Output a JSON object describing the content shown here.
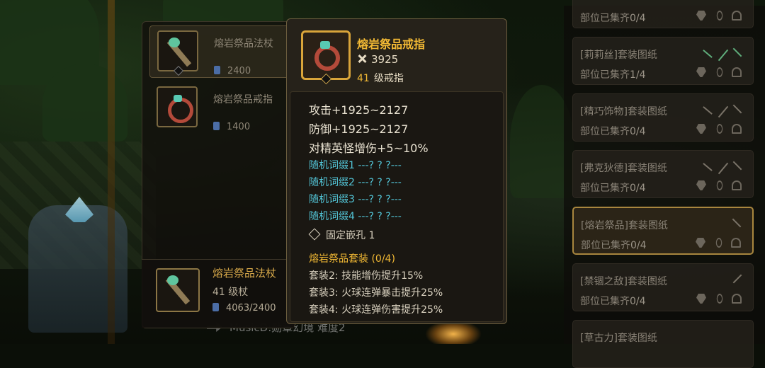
{
  "background": {
    "scene_text": "MusicD:勋章幻境 难度2"
  },
  "item_list": {
    "items": [
      {
        "name": "熔岩祭品法杖",
        "cost": "2400",
        "icon": "staff-icon",
        "selected": true
      },
      {
        "name": "熔岩祭品戒指",
        "cost": "1400",
        "icon": "ring-icon",
        "selected": false
      }
    ],
    "footer": {
      "name": "熔岩祭品法杖",
      "level": "41 级杖",
      "cost": "4063/2400",
      "icon": "staff-icon"
    }
  },
  "tooltip": {
    "name": "熔岩祭品戒指",
    "power": "3925",
    "level_num": "41",
    "level_text": "级戒指",
    "stats": [
      "攻击+1925~2127",
      "防御+1925~2127",
      "对精英怪增伤+5~10%"
    ],
    "affixes": [
      "随机词缀1  ---? ? ?---",
      "随机词缀2  ---? ? ?---",
      "随机词缀3  ---? ? ?---",
      "随机词缀4  ---? ? ?---"
    ],
    "socket": "固定嵌孔 1",
    "set_title": "熔岩祭品套装 (0/4)",
    "set_bonuses": [
      "套装2:  技能增伤提升15%",
      "套装3:  火球连弹暴击提升25%",
      "套装4:  火球连弹伤害提升25%"
    ],
    "colors": {
      "gold": "#f2b934",
      "affix": "#53c6d8"
    }
  },
  "set_list": {
    "rows": [
      {
        "name": "",
        "progress_label": "部位已集齐",
        "progress": "0/4",
        "selected": false
      },
      {
        "name": "[莉莉丝]套装图纸",
        "progress_label": "部位已集齐",
        "progress": "1/4",
        "selected": false
      },
      {
        "name": "[精巧饰物]套装图纸",
        "progress_label": "部位已集齐",
        "progress": "0/4",
        "selected": false
      },
      {
        "name": "[弗克狄德]套装图纸",
        "progress_label": "部位已集齐",
        "progress": "0/4",
        "selected": false
      },
      {
        "name": "[熔岩祭品]套装图纸",
        "progress_label": "部位已集齐",
        "progress": "0/4",
        "selected": true
      },
      {
        "name": "[禁锢之敌]套装图纸",
        "progress_label": "部位已集齐",
        "progress": "0/4",
        "selected": false
      },
      {
        "name": "[草古力]套装图纸",
        "progress_label": "",
        "progress": "",
        "selected": false
      }
    ]
  }
}
